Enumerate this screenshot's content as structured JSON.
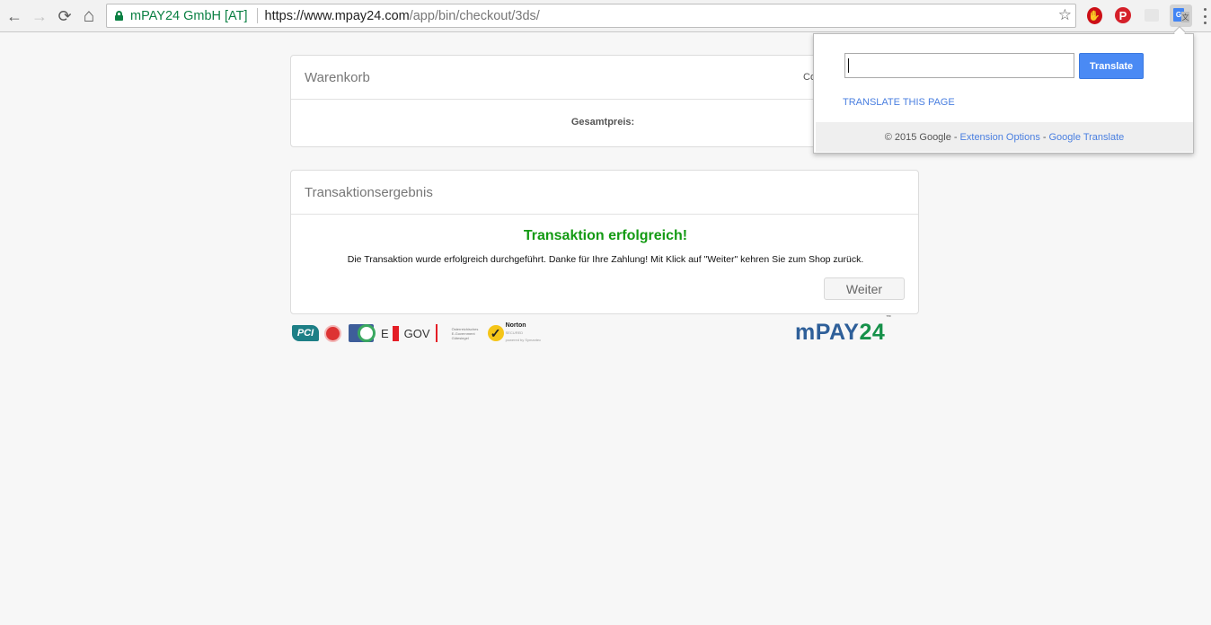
{
  "browser": {
    "back_icon": "←",
    "forward_icon": "→",
    "reload_icon": "⟳",
    "home_icon": "⌂",
    "cert_name": "mPAY24 GmbH [AT]",
    "url_scheme": "https://",
    "url_host": "www.mpay24.com",
    "url_path": "/app/bin/checkout/3ds/",
    "star_icon": "☆",
    "extensions": {
      "opera_glyph": "✋",
      "pinterest_glyph": "P",
      "gt_g": "G",
      "gt_t": "文"
    }
  },
  "cart": {
    "title": "Warenkorb",
    "column_header_partial": "Co",
    "total_label": "Gesamtpreis:"
  },
  "result": {
    "title": "Transaktionsergebnis",
    "status": "Transaktion erfolgreich!",
    "status_color": "#139a13",
    "message": "Die Transaktion wurde erfolgreich durchgeführt. Danke für Ihre Zahlung! Mit Klick auf \"Weiter\" kehren Sie zum Shop zurück.",
    "continue_label": "Weiter"
  },
  "footer": {
    "pci_label": "PCI",
    "egov_e": "E",
    "egov_gov": "GOV",
    "egov_text": "Österreichisches E-Government Gütesiegel",
    "norton_check": "✓",
    "norton_name": "Norton",
    "norton_sub": "SECURED",
    "norton_powered": "powered by Symantec",
    "mpay_m": "mPAY",
    "mpay_n": "24",
    "mpay_tm": "™"
  },
  "translate_popup": {
    "input_value": "",
    "translate_label": "Translate",
    "translate_page_label": "TRANSLATE THIS PAGE",
    "copyright": "© 2015 Google",
    "dash": "-",
    "extension_options_label": "Extension Options",
    "google_translate_label": "Google Translate",
    "button_color": "#4a8af4"
  }
}
